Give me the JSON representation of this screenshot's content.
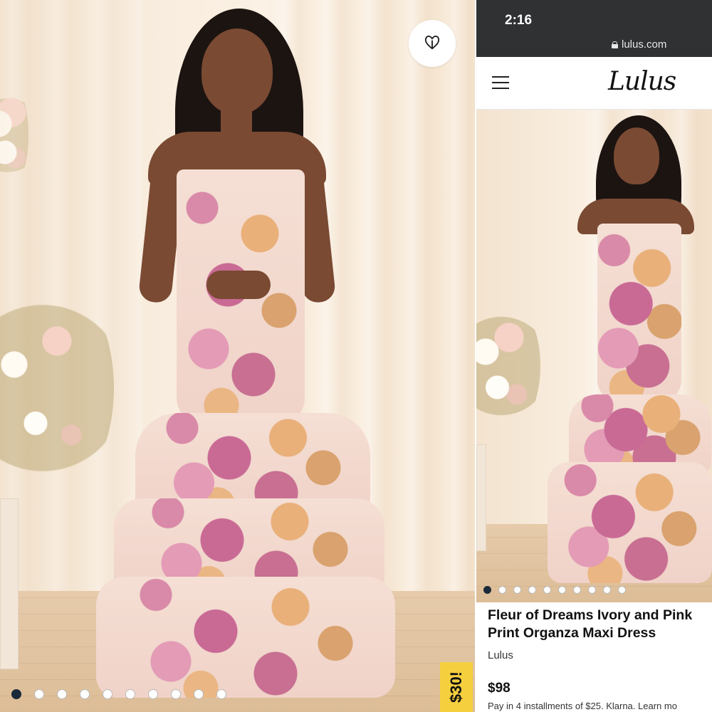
{
  "left_panel": {
    "favorite_icon": "heart-icon",
    "carousel": {
      "count": 10,
      "active_index": 0
    },
    "price_tab": "$30!"
  },
  "phone": {
    "status_bar": {
      "time": "2:16",
      "url": "lulus.com",
      "lock_icon": "lock-icon"
    },
    "header": {
      "menu_icon": "hamburger-menu-icon",
      "logo": "Lulus"
    },
    "carousel": {
      "count": 10,
      "active_index": 0
    },
    "product": {
      "title": "Fleur of Dreams Ivory and Pink Print Organza Maxi Dress",
      "brand": "Lulus",
      "price": "$98",
      "installments": "Pay in 4 installments of $25. Klarna. Learn mo"
    }
  },
  "colors": {
    "status_bar": "#2f3133",
    "price_tab": "#f6cf3f",
    "active_dot": "#1b2a3a"
  }
}
